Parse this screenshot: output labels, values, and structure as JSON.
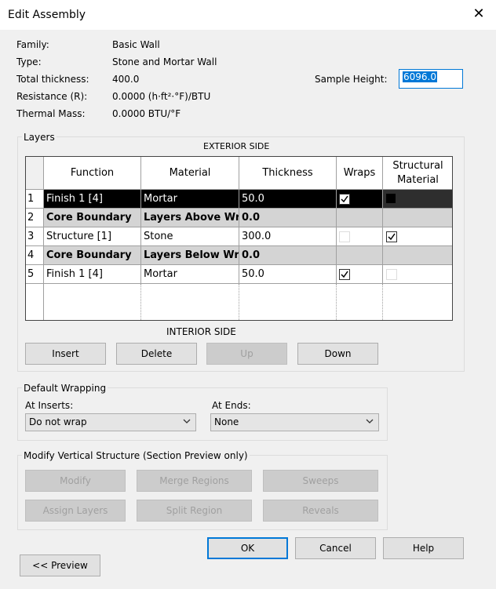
{
  "window": {
    "title": "Edit Assembly",
    "close_symbol": "✕"
  },
  "props": {
    "family_label": "Family:",
    "family_value": "Basic Wall",
    "type_label": "Type:",
    "type_value": "Stone and Mortar Wall",
    "thickness_label": "Total thickness:",
    "thickness_value": "400.0",
    "resistance_label": "Resistance (R):",
    "resistance_value": "0.0000 (h·ft²·°F)/BTU",
    "mass_label": "Thermal Mass:",
    "mass_value": "0.0000 BTU/°F",
    "sample_height_label": "Sample Height:",
    "sample_height_value": "6096.0"
  },
  "layers": {
    "group_label": "Layers",
    "exterior_label": "EXTERIOR SIDE",
    "interior_label": "INTERIOR SIDE",
    "columns": [
      "Function",
      "Material",
      "Thickness",
      "Wraps",
      "Structural\nMaterial"
    ],
    "rows": [
      {
        "no": "1",
        "function": "Finish 1 [4]",
        "material": "Mortar",
        "thickness": "50.0",
        "wraps": true,
        "structural": false,
        "selected": true
      },
      {
        "no": "2",
        "function": "Core Boundary",
        "material": "Layers Above Wr",
        "thickness": "0.0",
        "boundary": true
      },
      {
        "no": "3",
        "function": "Structure [1]",
        "material": "Stone",
        "thickness": "300.0",
        "wraps": false,
        "structural": true
      },
      {
        "no": "4",
        "function": "Core Boundary",
        "material": "Layers Below Wr",
        "thickness": "0.0",
        "boundary": true
      },
      {
        "no": "5",
        "function": "Finish 1 [4]",
        "material": "Mortar",
        "thickness": "50.0",
        "wraps": true,
        "structural": false
      }
    ],
    "buttons": {
      "insert": "Insert",
      "delete": "Delete",
      "up": "Up",
      "down": "Down"
    }
  },
  "wrapping": {
    "group_label": "Default Wrapping",
    "inserts_label": "At Inserts:",
    "inserts_value": "Do not wrap",
    "ends_label": "At  Ends:",
    "ends_value": "None"
  },
  "vertical": {
    "group_label": "Modify Vertical Structure (Section Preview only)",
    "modify": "Modify",
    "merge": "Merge Regions",
    "sweeps": "Sweeps",
    "assign": "Assign Layers",
    "split": "Split Region",
    "reveals": "Reveals"
  },
  "footer": {
    "ok": "OK",
    "cancel": "Cancel",
    "help": "Help",
    "preview": "<< Preview"
  },
  "colors": {
    "accent": "#0078d7",
    "selected_row": "#000000",
    "boundary_row": "#d4d4d4"
  }
}
